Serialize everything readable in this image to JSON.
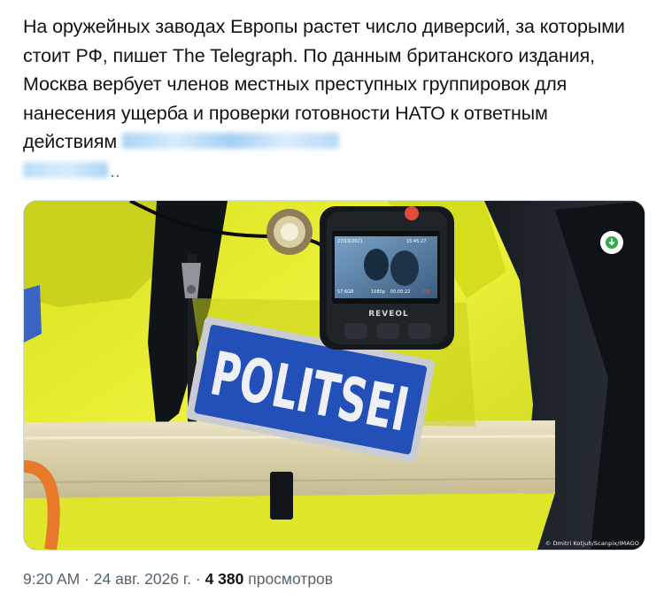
{
  "tweet": {
    "text": "На оружейных заводах Европы растет число диверсий, за которыми стоит РФ, пишет The Telegraph. По данным британского издания, Москва вербует членов местных преступных группировок для нанесения ущерба и проверки готовности НАТО к ответным действиям",
    "ellipsis": "..",
    "link_color": "#1d9bf0"
  },
  "media": {
    "patch_text": "POLITSEI",
    "camera_brand": "REVEOL",
    "camera_screen_date": "27/10/2021",
    "camera_screen_time": "15:45:27",
    "camera_screen_res": "1080p",
    "camera_screen_clock": "00:00:22",
    "camera_screen_mb": "57.6GB",
    "camera_screen_rec": "REC",
    "credit": "© Dmitri Kotjuh/Scanpix/IMAGO",
    "download_icon": "download-arrow-icon"
  },
  "meta": {
    "time": "9:20 AM",
    "separator1": " · ",
    "date": "24 авг. 2026 г.",
    "separator2": " · ",
    "views_count": "4 380",
    "views_label": " просмотров"
  },
  "colors": {
    "text": "#0f1419",
    "secondary": "#536471",
    "vest_yellow": "#e8ec2a",
    "patch_blue": "#2350b8"
  }
}
